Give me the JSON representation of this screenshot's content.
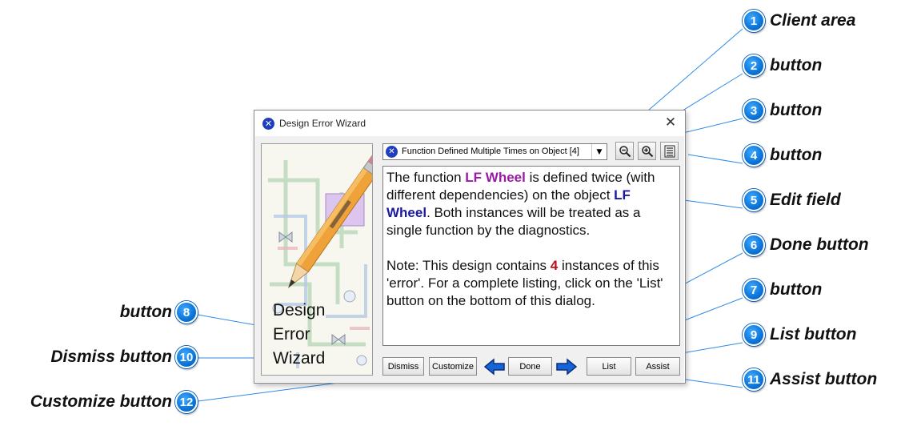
{
  "callouts": [
    {
      "number": "1",
      "label": "Client area"
    },
    {
      "number": "2",
      "label": "button"
    },
    {
      "number": "3",
      "label": "button"
    },
    {
      "number": "4",
      "label": "button"
    },
    {
      "number": "5",
      "label": "Edit field"
    },
    {
      "number": "6",
      "label": "Done button"
    },
    {
      "number": "7",
      "label": "button"
    },
    {
      "number": "8",
      "label": "button"
    },
    {
      "number": "9",
      "label": "List button"
    },
    {
      "number": "10",
      "label": "Dismiss button"
    },
    {
      "number": "11",
      "label": "Assist button"
    },
    {
      "number": "12",
      "label": "Customize button"
    }
  ],
  "dialog": {
    "title": "Design Error Wizard",
    "title_icon": "error-x-icon",
    "close_glyph": "✕",
    "illustration": {
      "words": [
        "Design",
        "Error",
        "Wizard"
      ],
      "icon": "pencil-schematic-icon"
    },
    "error_selector": {
      "value": "Function Defined Multiple Times on Object [4]",
      "icon": "error-x-icon",
      "arrow": "▼"
    },
    "toolbar": {
      "zoom_out_icon": "zoom-out-icon",
      "zoom_in_icon": "zoom-in-icon",
      "list_view_icon": "list-view-icon"
    },
    "message": {
      "p1_a": "The function ",
      "p1_fn": "LF Wheel",
      "p1_b": " is defined twice (with different dependencies) on the object ",
      "p1_obj": "LF Wheel",
      "p1_c": ". Both instances will be treated as a single function by the diagnostics.",
      "p2_a": "Note: This design contains ",
      "p2_count": "4",
      "p2_b": " instances of this 'error'. For a complete listing, click on the 'List' button on the bottom of this dialog."
    },
    "buttons": {
      "dismiss": "Dismiss",
      "customize": "Customize",
      "done": "Done",
      "list": "List",
      "assist": "Assist"
    },
    "colors": {
      "function_name": "#9a1aa8",
      "object_name": "#1a1aa0",
      "count": "#b5121b",
      "arrow_fill": "#1565d8"
    }
  }
}
